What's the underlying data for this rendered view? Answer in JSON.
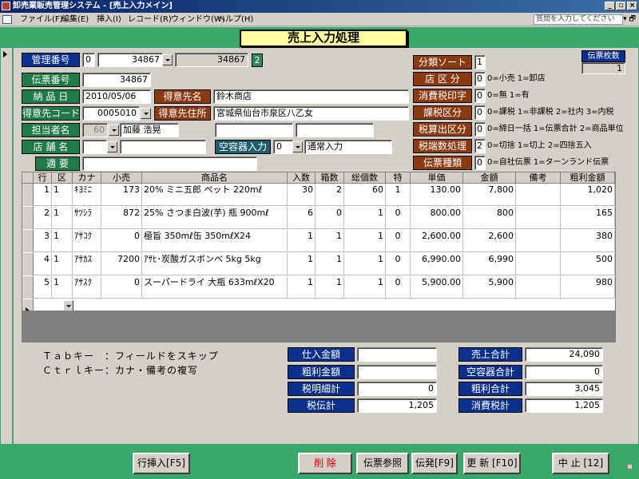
{
  "window": {
    "title": "卸売業販売管理システム - [売上入力メイン]",
    "buttons": [
      "_",
      "▫",
      "×"
    ]
  },
  "menu": {
    "items": [
      "ファイル(F)",
      "編集(E)",
      "挿入(I)",
      "レコード(R)",
      "ウィンドウ(W)",
      "ヘルプ(H)"
    ],
    "question_placeholder": "質問を入力してください",
    "mdi_controls": "▾ 🗗"
  },
  "form": {
    "title": "売上入力処理",
    "colors": {
      "background": "#39a86b",
      "label_blue": "#0a2f8c",
      "label_brown": "#8b3a0f"
    }
  },
  "header": {
    "kanri_label": "管理番号",
    "kanri_prefix": "0",
    "kanri_value": "34867",
    "kanri_value2": "34867",
    "kanri_badge": "2",
    "denpyo_label": "伝票番号",
    "denpyo_value": "34867",
    "nouhin_label": "納 品 日",
    "nouhin_value": "2010/05/06",
    "tokuisaki_name_label": "得意先名",
    "tokuisaki_name_value": "鈴木商店",
    "tokuisaki_code_label": "得意先コード",
    "tokuisaki_code_value": "0005010",
    "tokuisaki_addr_label": "得意先住所",
    "tokuisaki_addr_value": "宮城県仙台市泉区八乙女",
    "tantou_label": "担当者名",
    "tantou_code": "60",
    "tantou_name": "加藤 浩晃",
    "tenpo_label": "店 舗 名",
    "kuuyouki_label": "空容器入力",
    "kuuyouki_code": "0",
    "kuuyouki_value": "通常入力",
    "tekiyou_label": "適 要"
  },
  "right_panel": {
    "bunrui_label": "分類ソート",
    "bunrui_value": "1",
    "tenku_label": "店 区 分",
    "tenku_value": "0",
    "tenku_hint": "0=小売 1=卸店",
    "shohizei_label": "消費税印字",
    "shohizei_value": "0",
    "shohizei_hint": "0=無 1=有",
    "kazei_label": "課税区分",
    "kazei_value": "0",
    "kazei_hint": "0=課税 1=非課税 2=社内 3=内税",
    "zeisan_label": "税算出区分",
    "zeisan_value": "0",
    "zeisan_hint": "0=締日一括 1=伝票合計 2=商品単位",
    "hasuu_label": "税端数処理",
    "hasuu_value": "2",
    "hasuu_hint": "0=切捨 1=切上 2=四捨五入",
    "denshu_label": "伝票種類",
    "denshu_value": "0",
    "denshu_hint": "0=自社伝票 1=ターンランド伝票",
    "maisuu_label": "伝票枚数",
    "maisuu_value": "1"
  },
  "table": {
    "columns": [
      "行",
      "区",
      "カナ",
      "小売",
      "商品名",
      "入数",
      "箱数",
      "総個数",
      "特",
      "単価",
      "金額",
      "備考",
      "粗利金額"
    ],
    "rows": [
      [
        "1",
        "1",
        "ｷﾖﾐﾆ",
        "173",
        "20% ミニ五郎 ペット 220mℓ",
        "30",
        "2",
        "60",
        "1",
        "130.00",
        "7,800",
        "",
        "1,020"
      ],
      [
        "2",
        "1",
        "ｻﾂｼﾗ",
        "872",
        "25% さつま白波(芋) 瓶 900mℓ",
        "6",
        "0",
        "1",
        "0",
        "800.00",
        "800",
        "",
        "165"
      ],
      [
        "3",
        "1",
        "ｱｻｺｸ",
        "0",
        "極旨 350mℓ缶          350mℓX24",
        "1",
        "1",
        "1",
        "0",
        "2,600.00",
        "2,600",
        "",
        "380"
      ],
      [
        "4",
        "1",
        "ｱｻｶｽ",
        "7200",
        "ｱｻﾋ･炭酸ガスボンベ  5kg   5kg",
        "1",
        "1",
        "1",
        "0",
        "6,990.00",
        "6,990",
        "",
        "500"
      ],
      [
        "5",
        "1",
        "ｱｻｽｸ",
        "0",
        "スーパードライ 大瓶   633mℓX20",
        "1",
        "1",
        "1",
        "0",
        "5,900.00",
        "5,900",
        "",
        "980"
      ]
    ]
  },
  "hints": {
    "tab": "Ｔａｂキー　：フィールドをスキップ",
    "ctrl": "Ｃｔｒｌキー：カナ・備考の複写"
  },
  "totals": {
    "shiire_label": "仕入金額",
    "shiire_value": "",
    "arari_label": "粗利金額",
    "arari_value": "",
    "zeimei_label": "税明細計",
    "zeimei_value": "0",
    "zeiden_label": "税伝計",
    "zeiden_value": "1,205",
    "uriage_label": "売上合計",
    "uriage_value": "24,090",
    "kuuyouki_label": "空容器合計",
    "kuuyouki_value": "0",
    "arari_goukei_label": "粗利合計",
    "arari_goukei_value": "3,045",
    "shohizei_label": "消費税計",
    "shohizei_value": "1,205"
  },
  "footer": {
    "insert_row": "行挿入[F5]",
    "delete": "削 除",
    "reference": "伝票参照",
    "issue": "伝発[F9]",
    "update": "更 新 [F10]",
    "cancel": "中 止 [12]"
  }
}
